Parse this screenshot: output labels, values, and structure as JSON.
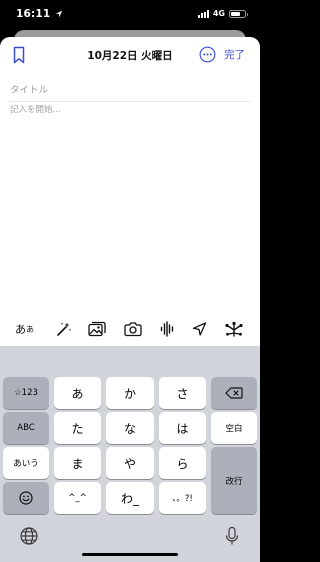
{
  "status_bar": {
    "time": "16:11",
    "network": "4G"
  },
  "header": {
    "title": "10月22日 火曜日",
    "done_label": "完了"
  },
  "editor": {
    "title_placeholder": "タイトル",
    "body_placeholder": "記入を開始..."
  },
  "toolbar": {
    "kana_label": "あ",
    "kana_small": "あ",
    "icons": [
      "text-style-icon",
      "magic-wand-icon",
      "photo-library-icon",
      "camera-icon",
      "audio-waveform-icon",
      "location-arrow-icon",
      "activity-icon"
    ]
  },
  "keyboard": {
    "keys": {
      "numbers": "☆123",
      "abc": "ABC",
      "aiu": "あいう",
      "a": "あ",
      "ka": "か",
      "sa": "さ",
      "ta": "た",
      "na": "な",
      "ha": "は",
      "ma": "ま",
      "ya": "や",
      "ra": "ら",
      "kaomoji": "^_^",
      "wa": "わ_",
      "punct": "、。?!",
      "space": "空白",
      "enter": "改行"
    }
  },
  "colors": {
    "accent": "#3b4ed4",
    "keyboard_bg": "#d2d4db",
    "function_key": "#abb0bb"
  }
}
